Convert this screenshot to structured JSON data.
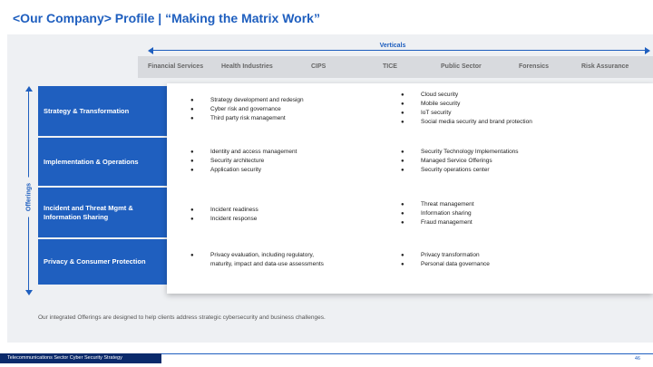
{
  "title": "<Our Company> Profile | “Making the Matrix Work”",
  "verticals_label": "Verticals",
  "offerings_label": "Offerings",
  "columns": [
    "Financial Services",
    "Health Industries",
    "CIPS",
    "TICE",
    "Public Sector",
    "Forensics",
    "Risk Assurance"
  ],
  "rows": [
    {
      "label": "Strategy & Transformation",
      "left_bullets": [
        "Strategy development and redesign",
        "Cyber risk and governance",
        "Third party risk management"
      ],
      "right_bullets": [
        "Cloud security",
        "Mobile security",
        "IoT security",
        "Social media security and brand protection"
      ]
    },
    {
      "label": "Implementation & Operations",
      "left_bullets": [
        "Identity and access management",
        "Security architecture",
        "Application security"
      ],
      "right_bullets": [
        "Security Technology Implementations",
        "Managed Service Offerings",
        "Security operations center"
      ]
    },
    {
      "label": "Incident and Threat Mgmt & Information Sharing",
      "left_bullets": [
        "Incident readiness",
        "Incident response"
      ],
      "right_bullets": [
        "Threat management",
        "Information sharing",
        "Fraud management"
      ]
    },
    {
      "label": "Privacy & Consumer Protection",
      "left_bullets": [
        "Privacy evaluation, including regulatory,",
        "maturity, impact and data-use assessments"
      ],
      "right_bullets": [
        "Privacy transformation",
        "Personal data governance"
      ]
    }
  ],
  "footnote": "Our integrated Offerings are designed to help clients address strategic cybersecurity and business challenges.",
  "footer": {
    "left": "Telecommunications Sector Cyber Security Strategy",
    "page": "46"
  },
  "colors": {
    "accent": "#1f5fbf",
    "footer_bar": "#0b2a6b",
    "panel": "#eef0f3"
  }
}
